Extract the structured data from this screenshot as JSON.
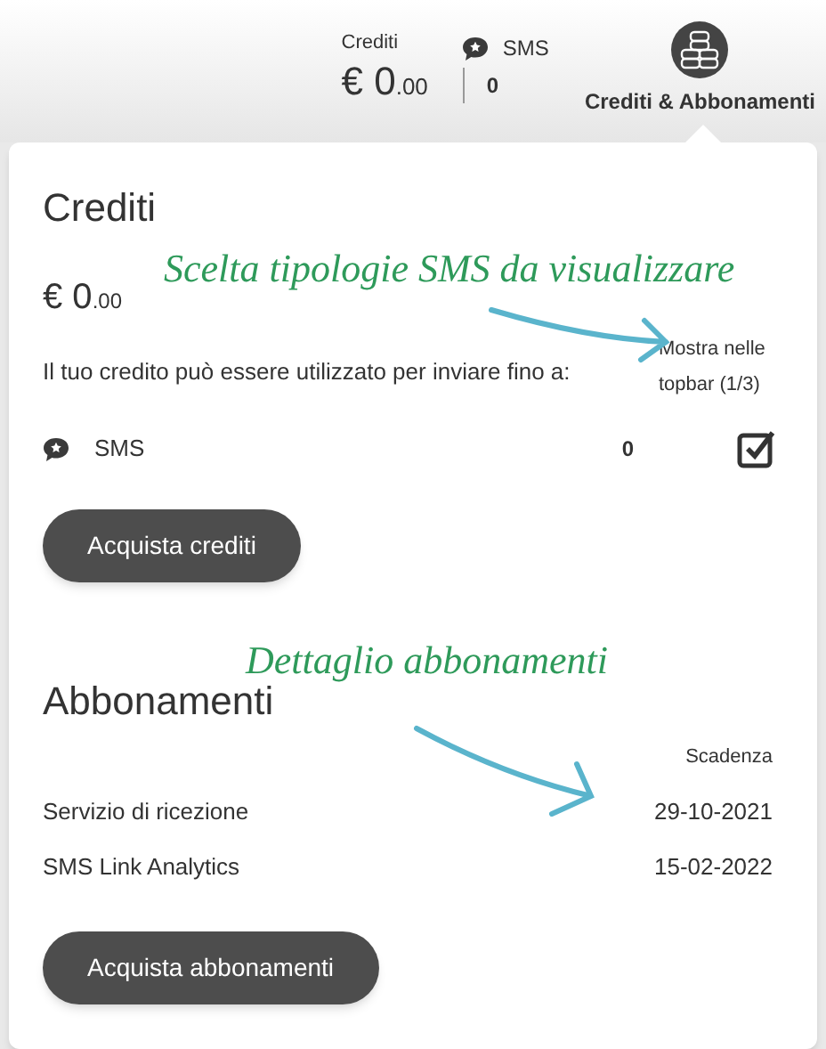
{
  "topbar": {
    "credits_label": "Crediti",
    "credits_amount": "€ 0",
    "credits_decimals": ".00",
    "sms_label": "SMS",
    "sms_count": "0",
    "menu_label": "Crediti & Abbonamenti"
  },
  "credits": {
    "title": "Crediti",
    "amount": "€ 0",
    "decimals": ".00",
    "description": "Il tuo credito può essere utilizzato per inviare fino a:",
    "show_header": "Mostra nelle topbar (1/3)",
    "items": [
      {
        "label": "SMS",
        "count": "0",
        "checked": true
      }
    ],
    "button": "Acquista crediti"
  },
  "subscriptions": {
    "title": "Abbonamenti",
    "column": "Scadenza",
    "rows": [
      {
        "name": "Servizio di ricezione",
        "expiry": "29-10-2021"
      },
      {
        "name": "SMS Link Analytics",
        "expiry": "15-02-2022"
      }
    ],
    "button": "Acquista abbonamenti"
  },
  "annotations": [
    {
      "text": "Scelta tipologie SMS da visualizzare"
    },
    {
      "text": "Dettaglio abbonamenti"
    }
  ]
}
